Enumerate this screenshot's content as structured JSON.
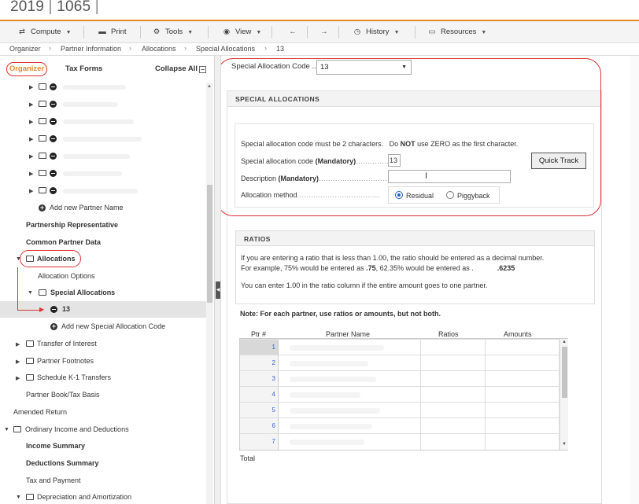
{
  "window": {
    "year": "2019",
    "form": "1065"
  },
  "toolbar": {
    "compute": "Compute",
    "print": "Print",
    "tools": "Tools",
    "view": "View",
    "back_icon": "arrow-left-icon",
    "forward_icon": "arrow-right-icon",
    "history": "History",
    "resources": "Resources"
  },
  "breadcrumb": [
    "Organizer",
    "Partner Information",
    "Allocations",
    "Special Allocations",
    "13"
  ],
  "left_panel": {
    "organizer_tab": "Organizer",
    "taxforms_tab": "Tax Forms",
    "collapse_all": "Collapse All",
    "collapse_symbol": "−",
    "add_partner": "Add new Partner Name",
    "partnership_rep": "Partnership Representative",
    "common_partner": "Common Partner Data",
    "allocations": "Allocations",
    "allocation_options": "Allocation Options",
    "special_allocations": "Special Allocations",
    "selected_code": "13",
    "add_special_alloc": "Add new Special Allocation Code",
    "transfer_interest": "Transfer of Interest",
    "partner_footnotes": "Partner Footnotes",
    "schedule_k1": "Schedule K-1 Transfers",
    "partner_book": "Partner Book/Tax Basis",
    "amended_return": "Amended Return",
    "ordinary_income": "Ordinary Income and Deductions",
    "income_summary": "Income Summary",
    "deductions_summary": "Deductions Summary",
    "tax_payment": "Tax and Payment",
    "depreciation": "Depreciation and Amortization"
  },
  "main": {
    "sa_code_label": "Special Allocation Code ...",
    "sa_code_value": "13",
    "special_allocations": {
      "header": "SPECIAL ALLOCATIONS",
      "note_prefix": "Special allocation code must be 2 characters.",
      "note_do": "Do",
      "note_not": "NOT",
      "note_suffix": "use ZERO as the first character.",
      "code_label": "Special allocation code",
      "mandatory": "(Mandatory)",
      "code_dots": "..............",
      "code_value": "13",
      "desc_label": "Description",
      "desc_dots": ".............................",
      "method_label": "Allocation method",
      "method_dots": "...................................",
      "quick_track": "Quick Track",
      "residual": "Residual",
      "piggyback": "Piggyback"
    },
    "ratios": {
      "header": "RATIOS",
      "line1": "If you are entering a ratio that is less than 1.00, the ratio should be entered as a decimal number.",
      "line2_a": "For example, 75% would be entered as",
      "line2_b": ".75",
      "line2_c": ", 62.35% would be entered as .",
      "line2_d": ".6235",
      "line3": "You can enter 1.00 in the ratio column if the entire amount goes to one partner."
    },
    "note": "Note: For each partner, use ratios or amounts, but not both.",
    "table": {
      "columns": [
        "Ptr #",
        "Partner Name",
        "Ratios",
        "Amounts"
      ],
      "rows": [
        "1",
        "2",
        "3",
        "4",
        "5",
        "6",
        "7"
      ]
    },
    "total_label": "Total"
  }
}
